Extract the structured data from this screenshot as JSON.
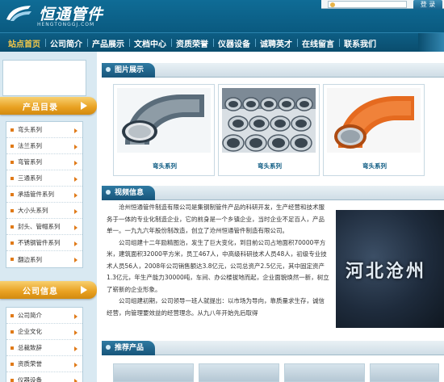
{
  "header": {
    "logo_title": "恒通管件",
    "logo_sub": "HENGTONGGJ.COM",
    "login_button": "登 录"
  },
  "nav": {
    "items": [
      {
        "label": "站点首页",
        "active": true
      },
      {
        "label": "公司简介",
        "active": false
      },
      {
        "label": "产品展示",
        "active": false
      },
      {
        "label": "文档中心",
        "active": false
      },
      {
        "label": "资质荣誉",
        "active": false
      },
      {
        "label": "仪器设备",
        "active": false
      },
      {
        "label": "诚聘英才",
        "active": false
      },
      {
        "label": "在线留言",
        "active": false
      },
      {
        "label": "联系我们",
        "active": false
      }
    ]
  },
  "sidebar": {
    "product_catalog_title": "产品目录",
    "product_items": [
      "弯头系列",
      "法兰系列",
      "弯管系列",
      "三通系列",
      "承插管件系列",
      "大小头系列",
      "封头、管帽系列",
      "不锈钢管件系列",
      "翻边系列"
    ],
    "company_info_title": "公司信息",
    "company_items": [
      "公司简介",
      "企业文化",
      "总裁致辞",
      "资质荣誉",
      "仪器设备"
    ]
  },
  "main": {
    "image_section_title": "图片展示",
    "products": [
      {
        "name": "弯头系列"
      },
      {
        "name": "弯头系列"
      },
      {
        "name": "弯头系列"
      }
    ],
    "video_section_title": "视频信息",
    "video_paragraphs": [
      "沧州恒通管件制造有限公司是集钢制管件产品的科研开发，生产经营和技术服务于一体的专业化制造企业，它的前身是一个乡镇企业，当时企业不足百人，产品单一。一九九六年股份制改造，创立了沧州恒通管件制造有限公司。",
      "公司组建十二年励精图治，发生了巨大变化，到目前公司占地面积70000平方米，建筑面积32000平方米，员工467人，中高级科研技术人员48人，初级专业技术人员56人，2008年公司销售额达3.8亿元，公司总资产2.5亿元，其中固定资产1.3亿元，年生产能力30000吨，车间、办公楼拔地而起，企业面貌焕然一新，树立了崭新的企业形象。",
      "公司组建初期，公司领导一班人就提出：以市场为导向，靠质量求生存，诚信经营，向管理要效益的经营理念。从九八年开始先后取得"
    ],
    "video_overlay_text": "河北沧州",
    "recommend_section_title": "推荐产品"
  }
}
